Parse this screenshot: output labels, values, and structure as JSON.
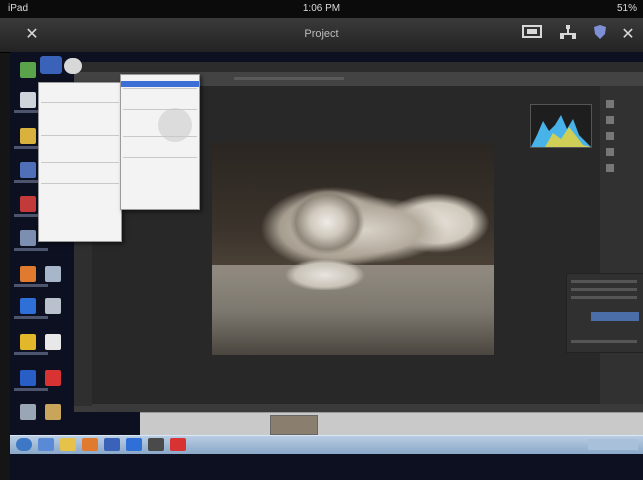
{
  "status_bar": {
    "left": "iPad",
    "time": "1:06 PM",
    "battery": "51%"
  },
  "top_bar": {
    "title": "Project"
  },
  "icons": {
    "close": "close-icon",
    "monitor": "monitor-icon",
    "network": "network-icon",
    "shield": "shield-icon",
    "exit": "close-icon"
  },
  "colors": {
    "highlight": "#3d6fd6",
    "ps_dark": "#282828",
    "taskbar": "#8aa8c9"
  }
}
